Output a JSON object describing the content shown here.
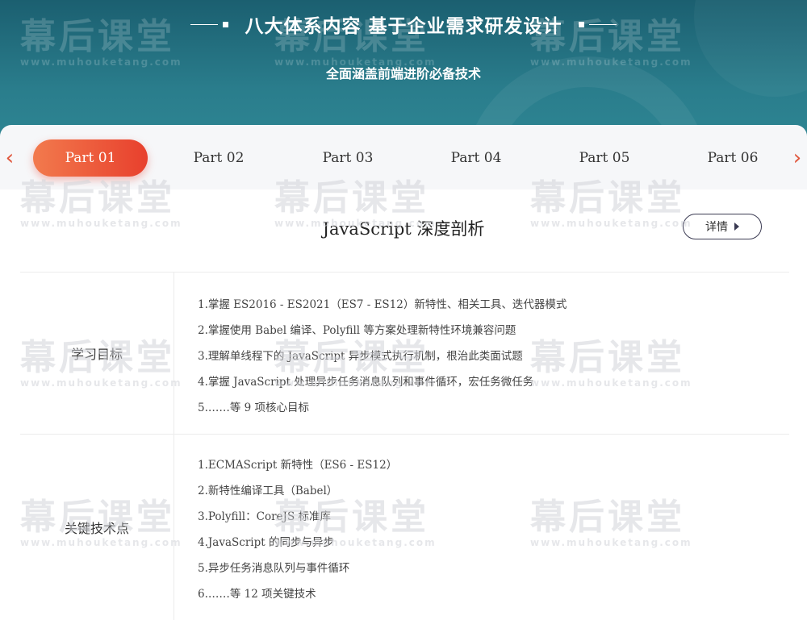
{
  "header": {
    "title": "八大体系内容 基于企业需求研发设计",
    "subtitle": "全面涵盖前端进阶必备技术"
  },
  "watermark": {
    "brand": "幕后课堂",
    "url": "www.muhouketang.com"
  },
  "tabs": {
    "items": [
      {
        "label": "Part 01",
        "active": true
      },
      {
        "label": "Part 02",
        "active": false
      },
      {
        "label": "Part 03",
        "active": false
      },
      {
        "label": "Part 04",
        "active": false
      },
      {
        "label": "Part 05",
        "active": false
      },
      {
        "label": "Part 06",
        "active": false
      }
    ],
    "prev_icon": "chevron-left-icon",
    "next_icon": "chevron-right-icon"
  },
  "course": {
    "title": "JavaScript 深度剖析",
    "detail_label": "详情",
    "detail_icon": "triangle-right-icon"
  },
  "sections": [
    {
      "label": "学习目标",
      "items": [
        "1.掌握 ES2016 - ES2021（ES7 - ES12）新特性、相关工具、迭代器模式",
        "2.掌握使用 Babel 编译、Polyfill 等方案处理新特性环境兼容问题",
        "3.理解单线程下的 JavaScript 异步模式执行机制，根治此类面试题",
        "4.掌握 JavaScript 处理异步任务消息队列和事件循环，宏任务微任务",
        "5.……等 9 项核心目标"
      ]
    },
    {
      "label": "关键技术点",
      "items": [
        "1.ECMAScript 新特性（ES6 - ES12）",
        "2.新特性编译工具（Babel）",
        "3.Polyfill：CoreJS 标准库",
        "4.JavaScript 的同步与异步",
        "5.异步任务消息队列与事件循环",
        "6.……等 12 项关键技术"
      ]
    }
  ],
  "colors": {
    "header_bg": "#1f6b7b",
    "accent_start": "#f27a4d",
    "accent_end": "#e8402d",
    "arrow": "#e0553b"
  }
}
